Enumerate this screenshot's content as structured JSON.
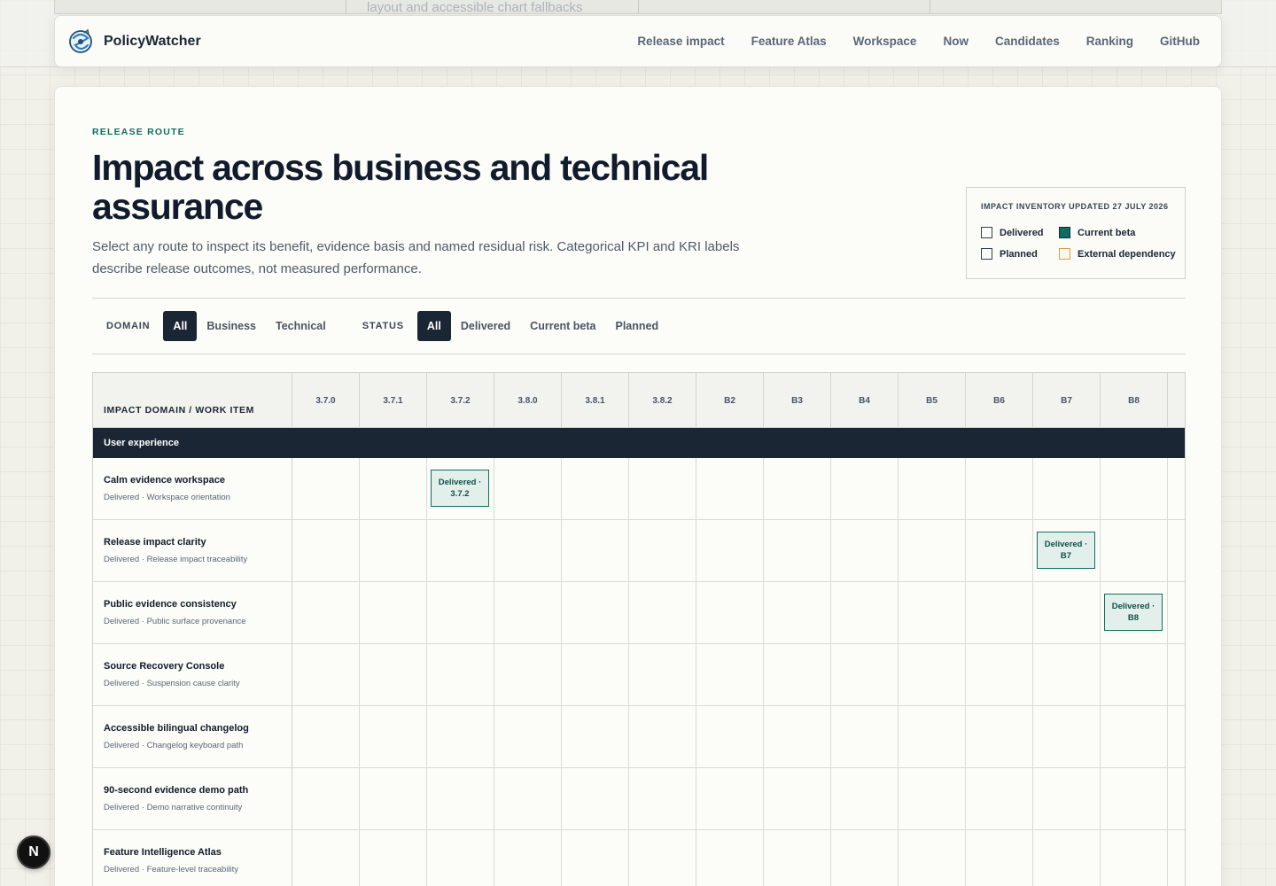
{
  "background": {
    "ghost_text": "layout and accessible chart fallbacks"
  },
  "nav": {
    "brand": "PolicyWatcher",
    "links": [
      "Release impact",
      "Feature Atlas",
      "Workspace",
      "Now",
      "Candidates",
      "Ranking",
      "GitHub"
    ]
  },
  "hero": {
    "eyebrow": "RELEASE ROUTE",
    "title": "Impact across business and technical assurance",
    "subtitle": "Select any route to inspect its benefit, evidence basis and named residual risk. Categorical KPI and KRI labels describe release outcomes, not measured performance."
  },
  "legend": {
    "title": "IMPACT INVENTORY UPDATED 27 JULY 2026",
    "items": [
      {
        "label": "Delivered",
        "swatch": "delivered"
      },
      {
        "label": "Current beta",
        "swatch": "beta"
      },
      {
        "label": "Planned",
        "swatch": "planned"
      },
      {
        "label": "External dependency",
        "swatch": "ext"
      }
    ]
  },
  "filters": {
    "domain_label": "DOMAIN",
    "domain_options": [
      "All",
      "Business",
      "Technical"
    ],
    "domain_selected": "All",
    "status_label": "STATUS",
    "status_options": [
      "All",
      "Delivered",
      "Current beta",
      "Planned"
    ],
    "status_selected": "All"
  },
  "table": {
    "first_header": "IMPACT DOMAIN / WORK ITEM",
    "columns": [
      "3.7.0",
      "3.7.1",
      "3.7.2",
      "3.8.0",
      "3.8.1",
      "3.8.2",
      "B2",
      "B3",
      "B4",
      "B5",
      "B6",
      "B7",
      "B8"
    ],
    "group": "User experience",
    "rows": [
      {
        "title": "Calm evidence workspace",
        "sub": "Delivered · Workspace orientation",
        "chip": "Delivered · 3.7.2",
        "chip_col": "3.7.2"
      },
      {
        "title": "Release impact clarity",
        "sub": "Delivered · Release impact traceability",
        "chip": "Delivered · B7",
        "chip_col": "B7"
      },
      {
        "title": "Public evidence consistency",
        "sub": "Delivered · Public surface provenance",
        "chip": "Delivered · B8",
        "chip_col": "B8"
      },
      {
        "title": "Source Recovery Console",
        "sub": "Delivered · Suspension cause clarity",
        "chip": null,
        "chip_col": null
      },
      {
        "title": "Accessible bilingual changelog",
        "sub": "Delivered · Changelog keyboard path",
        "chip": null,
        "chip_col": null
      },
      {
        "title": "90-second evidence demo path",
        "sub": "Delivered · Demo narrative continuity",
        "chip": null,
        "chip_col": null
      },
      {
        "title": "Feature Intelligence Atlas",
        "sub": "Delivered · Feature-level traceability",
        "chip": null,
        "chip_col": null
      }
    ]
  },
  "dev_badge": "N",
  "colors": {
    "accent": "#0f6e63",
    "ink": "#1b2635",
    "chip_fill": "#e3efea",
    "external": "#d9a04b"
  }
}
